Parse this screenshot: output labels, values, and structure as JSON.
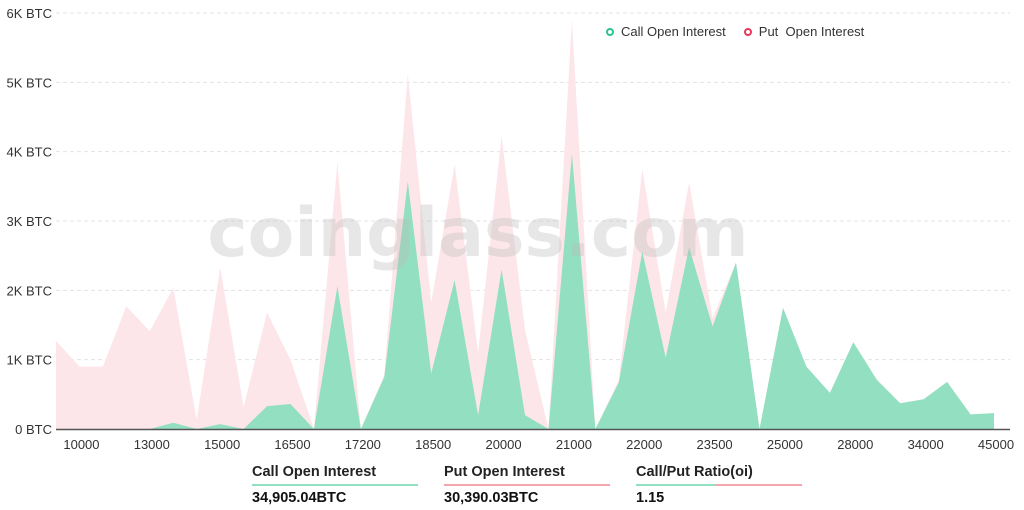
{
  "chart_data": {
    "type": "area",
    "title": "",
    "watermark": "coinglass.com",
    "xlabel": "",
    "ylabel": "",
    "ylim": [
      0,
      6000
    ],
    "y_ticks": [
      {
        "value": 0,
        "label": "0 BTC"
      },
      {
        "value": 1000,
        "label": "1K BTC"
      },
      {
        "value": 2000,
        "label": "2K BTC"
      },
      {
        "value": 3000,
        "label": "3K BTC"
      },
      {
        "value": 4000,
        "label": "4K BTC"
      },
      {
        "value": 5000,
        "label": "5K BTC"
      },
      {
        "value": 6000,
        "label": "6K BTC"
      }
    ],
    "grid": true,
    "legend_position": "top-right",
    "x_tick_labels": [
      {
        "index": 1,
        "label": "10000"
      },
      {
        "index": 4,
        "label": "13000"
      },
      {
        "index": 7,
        "label": "15000"
      },
      {
        "index": 10,
        "label": "16500"
      },
      {
        "index": 13,
        "label": "17200"
      },
      {
        "index": 16,
        "label": "18500"
      },
      {
        "index": 19,
        "label": "20000"
      },
      {
        "index": 22,
        "label": "21000"
      },
      {
        "index": 25,
        "label": "22000"
      },
      {
        "index": 28,
        "label": "23500"
      },
      {
        "index": 31,
        "label": "25000"
      },
      {
        "index": 34,
        "label": "28000"
      },
      {
        "index": 37,
        "label": "34000"
      },
      {
        "index": 40,
        "label": "45000"
      }
    ],
    "point_count": 41,
    "series": [
      {
        "name": "Put  Open Interest",
        "color": "#e8375a",
        "fill": "#fde6ea",
        "values": [
          1270,
          900,
          900,
          1770,
          1410,
          2040,
          130,
          2330,
          320,
          1680,
          1000,
          0,
          3850,
          0,
          780,
          5120,
          1820,
          3820,
          1100,
          4230,
          1430,
          0,
          5900,
          0,
          710,
          3750,
          1680,
          3560,
          1600,
          2400,
          0,
          1750,
          900,
          520,
          1250,
          710,
          370,
          430,
          680,
          210,
          230
        ]
      },
      {
        "name": "Call Open Interest",
        "color": "#2bc48a",
        "fill": "#93dfc1",
        "values": [
          0,
          0,
          0,
          0,
          0,
          90,
          0,
          70,
          0,
          330,
          360,
          0,
          2060,
          0,
          750,
          3570,
          800,
          2150,
          200,
          2300,
          200,
          0,
          3970,
          0,
          670,
          2560,
          1030,
          2620,
          1480,
          2400,
          0,
          1750,
          900,
          520,
          1250,
          710,
          370,
          430,
          680,
          210,
          230
        ]
      }
    ]
  },
  "legend": {
    "call_label": "Call Open Interest",
    "put_label": "Put  Open Interest"
  },
  "summary": {
    "call": {
      "label": "Call Open Interest",
      "value": "34,905.04BTC",
      "color": "#93dfc1"
    },
    "put": {
      "label": "Put Open Interest",
      "value": "30,390.03BTC",
      "color": "#f4a6ad"
    },
    "ratio": {
      "label": "Call/Put Ratio(oi)",
      "value": "1.15"
    }
  }
}
